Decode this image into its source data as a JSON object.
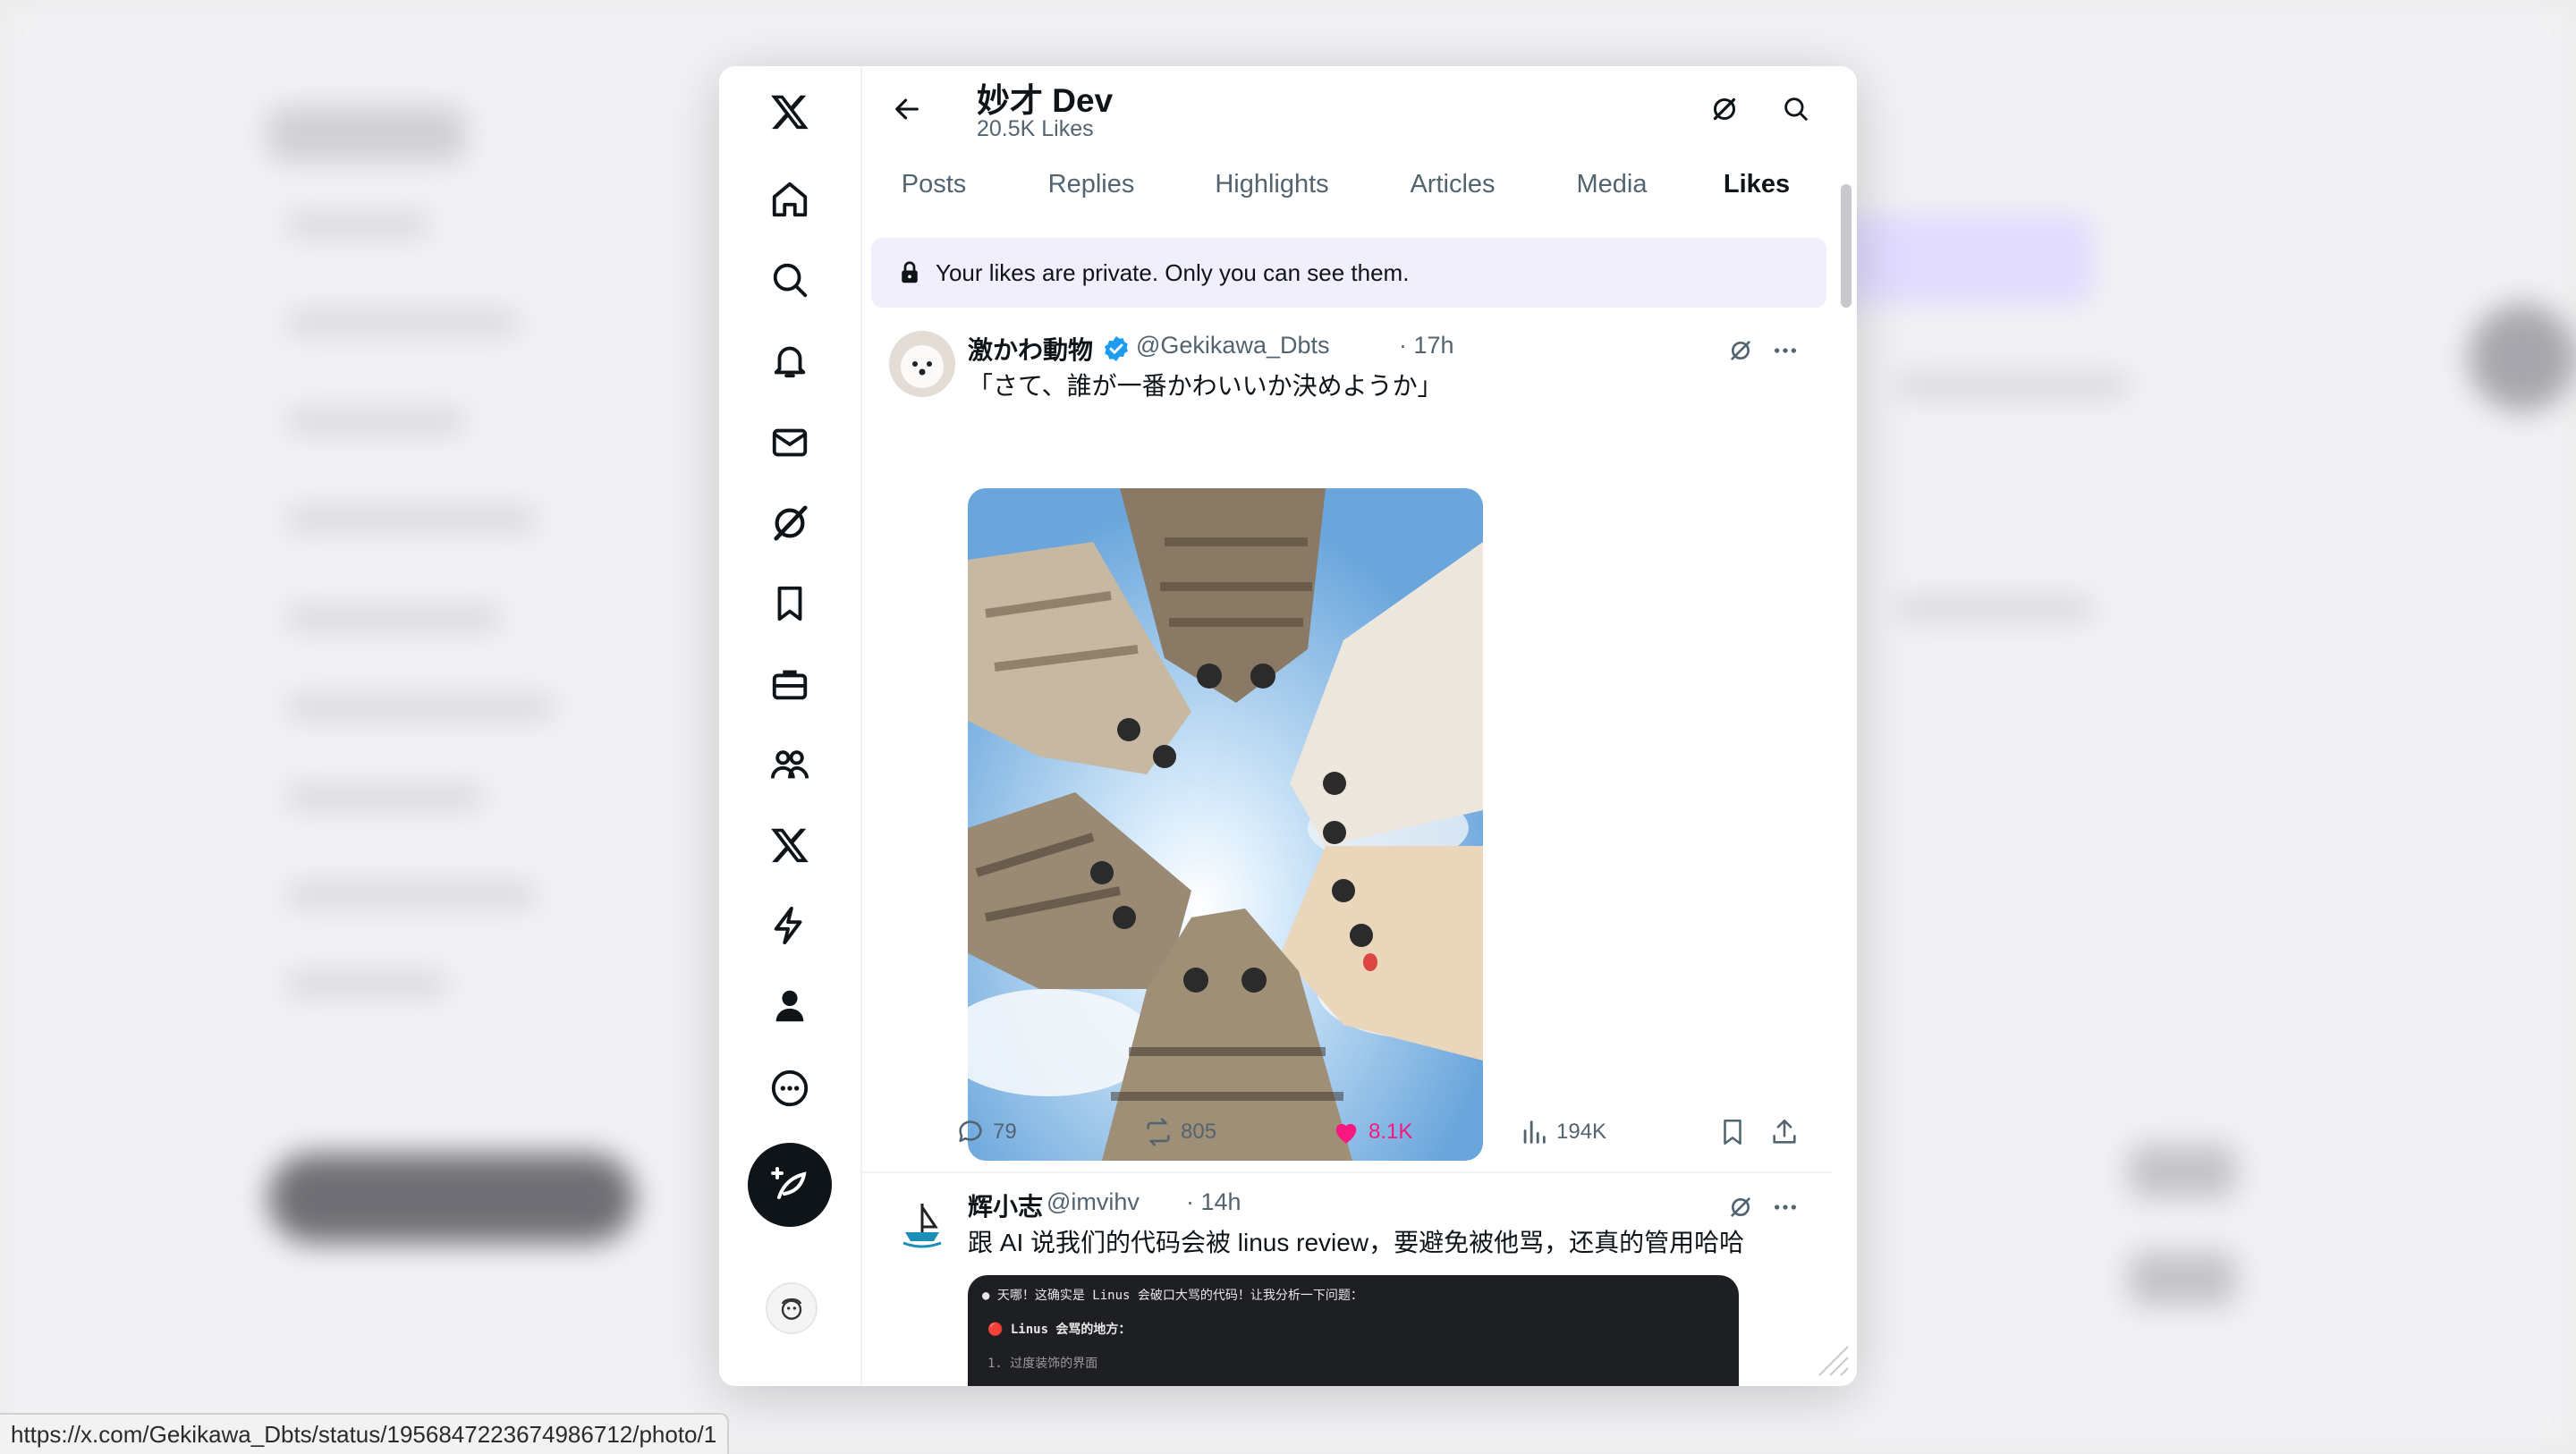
{
  "profile": {
    "name": "妙才 Dev",
    "likes_count": "20.5K Likes"
  },
  "tabs": [
    {
      "label": "Posts"
    },
    {
      "label": "Replies"
    },
    {
      "label": "Highlights"
    },
    {
      "label": "Articles"
    },
    {
      "label": "Media"
    },
    {
      "label": "Likes"
    }
  ],
  "active_tab": "Likes",
  "notice": {
    "text": "Your likes are private. Only you can see them."
  },
  "tweets": [
    {
      "name": "激かわ動物",
      "verified": true,
      "handle": "@Gekikawa_Dbts",
      "time": "· 17h",
      "text": "「さて、誰が一番かわいいか決めようか」",
      "media": "photo-cats-circle",
      "replies": "79",
      "reposts": "805",
      "likes": "8.1K",
      "views": "194K"
    },
    {
      "name": "辉小志",
      "handle": "@imvihv",
      "time": "· 14h",
      "text": "跟 AI 说我们的代码会被 linus review，要避免被他骂，还真的管用哈哈",
      "code_lines": [
        "● 天哪！这确实是 Linus 会破口大骂的代码！让我分析一下问题：",
        "🔴 Linus 会骂的地方：",
        "1. 过度装饰的界面"
      ]
    }
  ],
  "status_url": "https://x.com/Gekikawa_Dbts/status/1956847223674986712/photo/1",
  "colors": {
    "accent": "#7856ff",
    "like": "#f91880",
    "verified": "#1d9bf0",
    "text_primary": "#0f1419",
    "text_secondary": "#536471"
  }
}
